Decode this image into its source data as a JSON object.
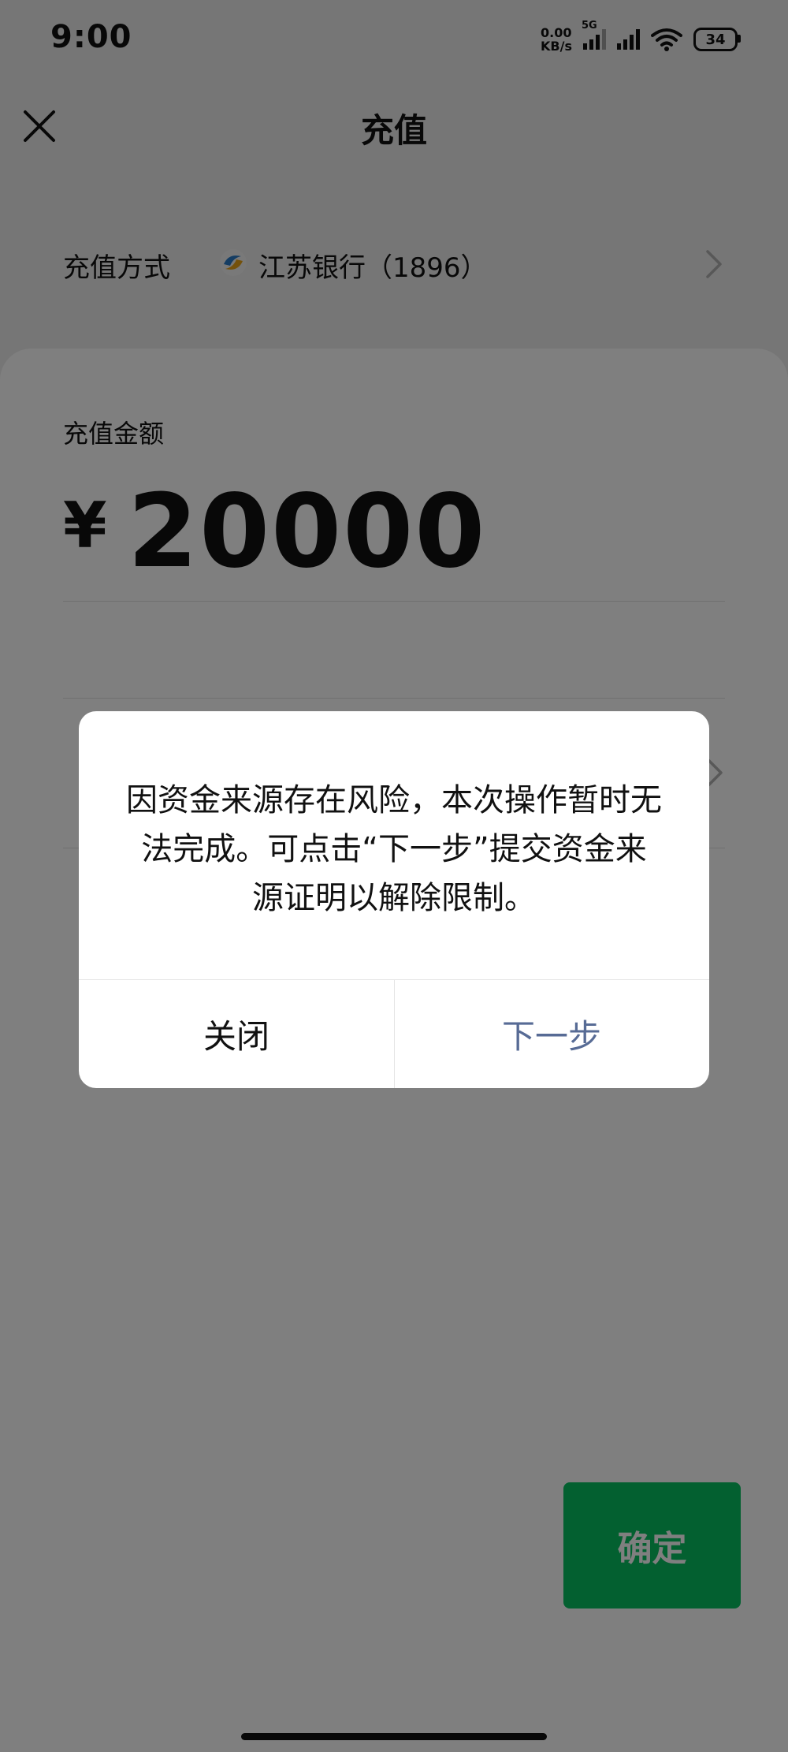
{
  "status_bar": {
    "time": "9:00",
    "net_speed_value": "0.00",
    "net_speed_unit": "KB/s",
    "network_type": "5G",
    "battery": "34"
  },
  "header": {
    "title": "充值",
    "close_icon": "close-icon"
  },
  "recharge_method": {
    "label": "充值方式",
    "bank_name": "江苏银行（1896）",
    "bank_icon": "jiangsu-bank-logo"
  },
  "amount": {
    "label": "充值金额",
    "currency_symbol": "¥",
    "value": "20000"
  },
  "confirm_button": {
    "label": "确定",
    "color": "#07c160"
  },
  "dialog": {
    "message": "因资金来源存在风险，本次操作暂时无法完成。可点击“下一步”提交资金来源证明以解除限制。",
    "close_label": "关闭",
    "next_label": "下一步",
    "next_color": "#576b95"
  }
}
